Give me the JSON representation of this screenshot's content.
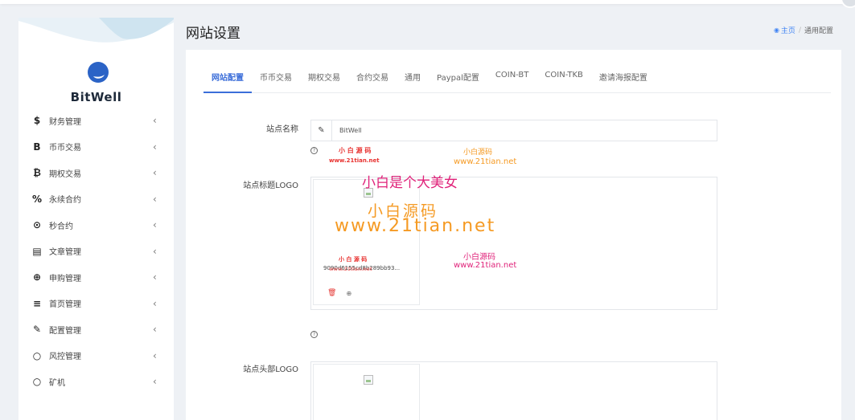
{
  "sidebar": {
    "brand": "BitWell",
    "items": [
      {
        "icon": "dollar-icon",
        "glyph": "$",
        "label": "财务管理"
      },
      {
        "icon": "b-letter-icon",
        "glyph": "B",
        "label": "币币交易"
      },
      {
        "icon": "bitcoin-icon",
        "glyph": "₿",
        "label": "期权交易"
      },
      {
        "icon": "percent-icon",
        "glyph": "%",
        "label": "永续合约"
      },
      {
        "icon": "dot-circle-icon",
        "glyph": "⊙",
        "label": "秒合约"
      },
      {
        "icon": "newspaper-icon",
        "glyph": "▤",
        "label": "文章管理"
      },
      {
        "icon": "life-ring-icon",
        "glyph": "⊕",
        "label": "申购管理"
      },
      {
        "icon": "bars-icon",
        "glyph": "≡",
        "label": "首页管理"
      },
      {
        "icon": "wrench-icon",
        "glyph": "✎",
        "label": "配置管理"
      },
      {
        "icon": "circle-icon",
        "glyph": "○",
        "label": "风控管理"
      },
      {
        "icon": "circle-icon",
        "glyph": "○",
        "label": "矿机"
      }
    ],
    "chevron": "‹"
  },
  "header": {
    "title": "网站设置",
    "breadcrumb_home": "主页",
    "breadcrumb_sep": "/",
    "breadcrumb_current": "通用配置"
  },
  "tabs": [
    "网站配置",
    "币币交易",
    "期权交易",
    "合约交易",
    "通用",
    "Paypal配置",
    "COIN-BT",
    "COIN-TKB",
    "邀请海报配置"
  ],
  "form": {
    "site_name_label": "站点名称",
    "site_name_value": "BitWell",
    "title_logo_label": "站点标题LOGO",
    "title_logo_filename": "9090d6155cd8b289bb93...",
    "header_logo_label": "站点头部LOGO"
  },
  "watermarks": {
    "small_red": "小 白 源 码",
    "small_red_url": "www.21tian.net",
    "small_org": "小白源码",
    "small_org_url": "www.21tian.net",
    "big_title": "小白是个大美女",
    "big_name": "小白源码",
    "big_url": "www.21tian.net",
    "mid_pink": "小白源码",
    "mid_pink_url": "www.21tian.net",
    "tiny_red": "小 白 源 码",
    "tiny_red_url": "www.21tian.net"
  },
  "colors": {
    "accent": "#3b6ed9",
    "danger": "#e53935",
    "watermark_red": "#e8312f",
    "watermark_orange": "#f59a23",
    "watermark_pink": "#e0237a"
  }
}
